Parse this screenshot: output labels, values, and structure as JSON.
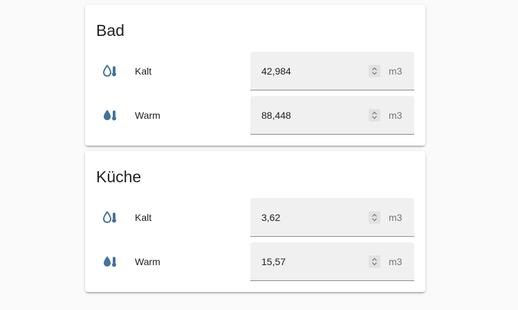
{
  "colors": {
    "icon": "#44739e",
    "card_bg": "#ffffff",
    "page_bg": "#fafafa",
    "field_bg": "#f0f0f0"
  },
  "cards": [
    {
      "title": "Bad",
      "rows": [
        {
          "label": "Kalt",
          "icon": "water-thermometer-outline-icon",
          "value": "42,984",
          "unit": "m3"
        },
        {
          "label": "Warm",
          "icon": "water-thermometer-icon",
          "value": "88,448",
          "unit": "m3"
        }
      ]
    },
    {
      "title": "Küche",
      "rows": [
        {
          "label": "Kalt",
          "icon": "water-thermometer-outline-icon",
          "value": "3,62",
          "unit": "m3"
        },
        {
          "label": "Warm",
          "icon": "water-thermometer-icon",
          "value": "15,57",
          "unit": "m3"
        }
      ]
    }
  ]
}
